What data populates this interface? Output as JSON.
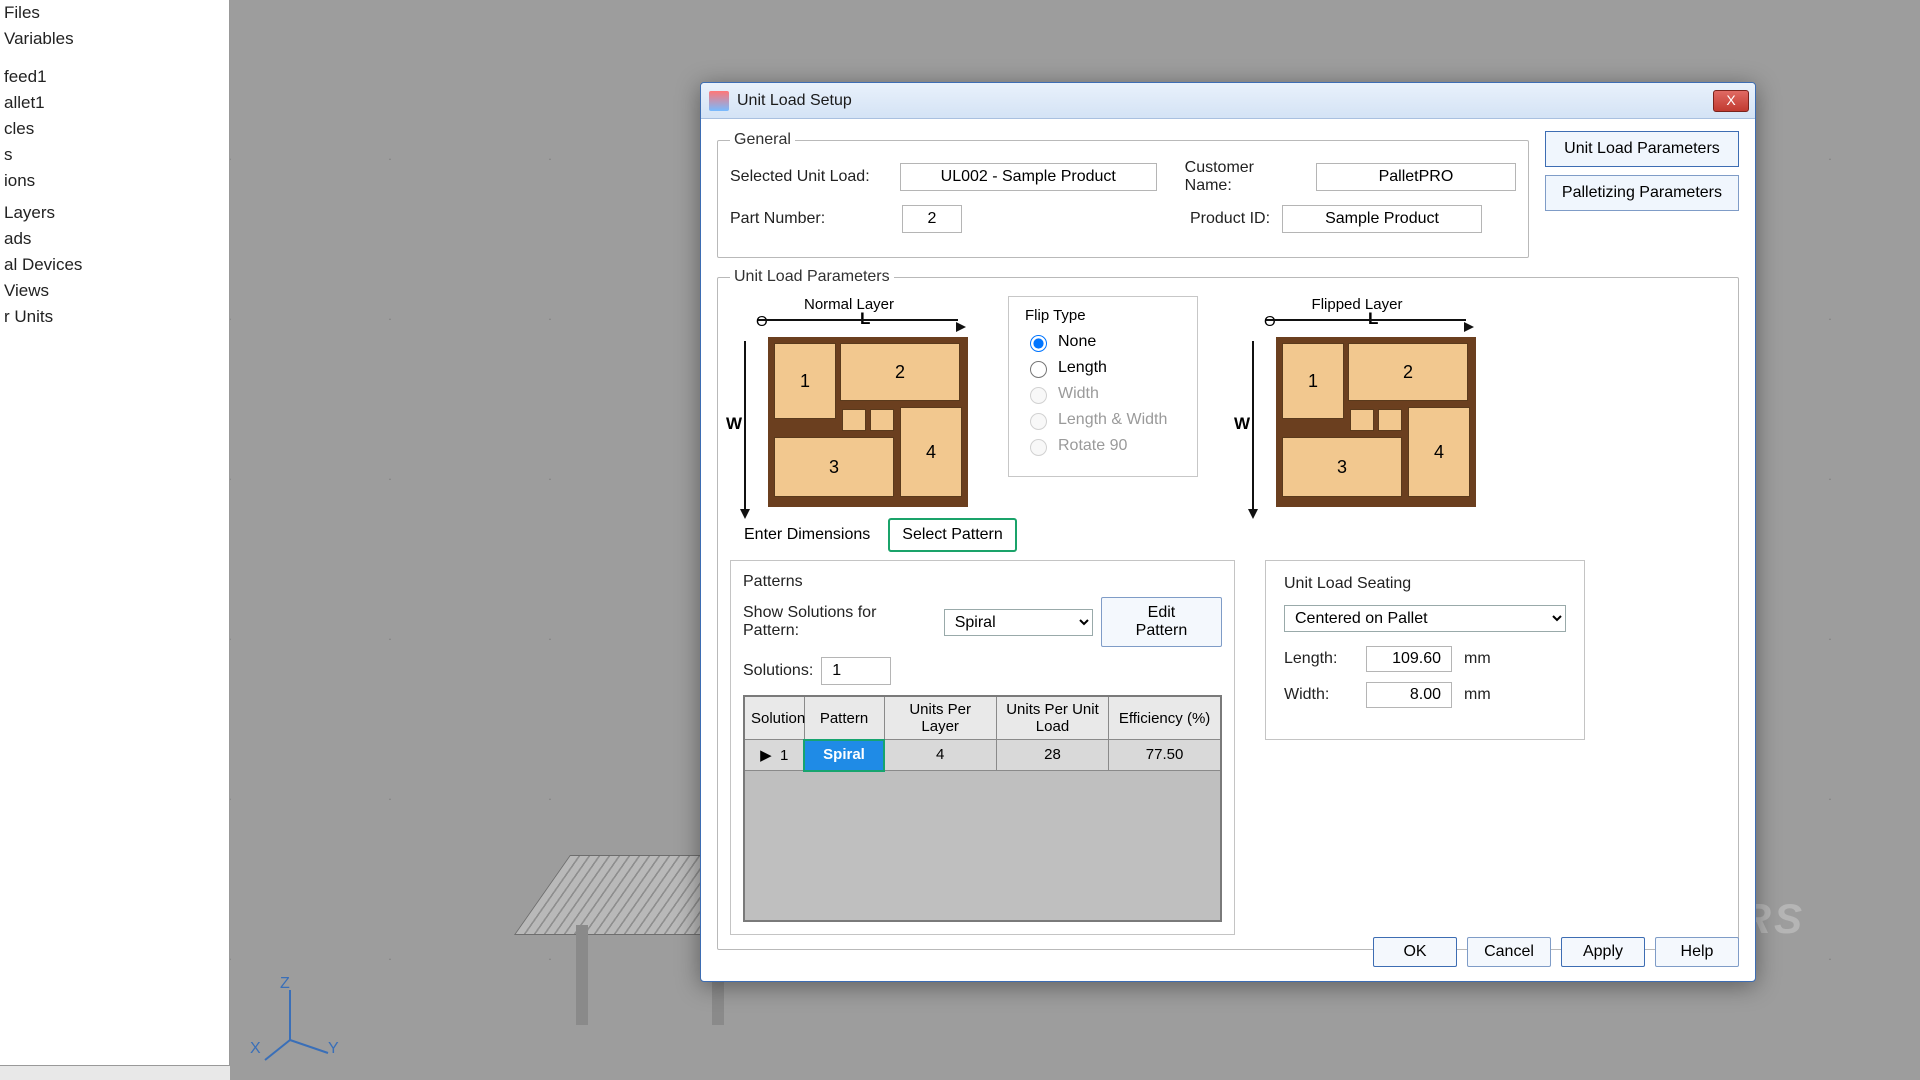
{
  "tree": {
    "items": [
      "Files",
      "Variables",
      "",
      "",
      "feed1",
      "allet1",
      "cles",
      "s",
      "ions",
      "",
      "Layers",
      "ads",
      "al Devices",
      "Views",
      "r Units"
    ]
  },
  "gizmo": {
    "x": "X",
    "y": "Y",
    "z": "Z"
  },
  "watermark": "REALPARS",
  "dialog": {
    "title": "Unit Load Setup",
    "close": "X",
    "general": {
      "legend": "General",
      "selectedUnitLoadLabel": "Selected Unit Load:",
      "selectedUnitLoad": "UL002 - Sample Product",
      "customerNameLabel": "Customer Name:",
      "customerName": "PalletPRO",
      "partNumberLabel": "Part Number:",
      "partNumber": "2",
      "productIdLabel": "Product ID:",
      "productId": "Sample Product",
      "tabs": {
        "unitLoad": "Unit Load Parameters",
        "palletizing": "Palletizing Parameters"
      }
    },
    "ulp": {
      "legend": "Unit Load Parameters",
      "normalLayer": "Normal Layer",
      "flippedLayer": "Flipped Layer",
      "flipType": {
        "title": "Flip Type",
        "options": {
          "none": "None",
          "length": "Length",
          "width": "Width",
          "lw": "Length & Width",
          "rot": "Rotate 90"
        }
      },
      "axis": {
        "o": "O",
        "l": "L",
        "w": "W"
      },
      "boxes": [
        "1",
        "2",
        "3",
        "4"
      ]
    },
    "subTabs": {
      "enter": "Enter Dimensions",
      "select": "Select Pattern"
    },
    "patterns": {
      "legend": "Patterns",
      "showLabel": "Show Solutions for Pattern:",
      "pattern": "Spiral",
      "editPattern": "Edit Pattern",
      "solutionsLabel": "Solutions:",
      "solutions": "1",
      "headers": [
        "Solution",
        "Pattern",
        "Units Per Layer",
        "Units Per Unit Load",
        "Efficiency (%)"
      ],
      "row": {
        "marker": "▶",
        "sol": "1",
        "pat": "Spiral",
        "upl": "4",
        "upul": "28",
        "eff": "77.50"
      }
    },
    "seating": {
      "legend": "Unit Load Seating",
      "mode": "Centered on Pallet",
      "lengthLabel": "Length:",
      "length": "109.60",
      "widthLabel": "Width:",
      "width": "8.00",
      "unit": "mm"
    },
    "footer": {
      "ok": "OK",
      "cancel": "Cancel",
      "apply": "Apply",
      "help": "Help"
    }
  }
}
